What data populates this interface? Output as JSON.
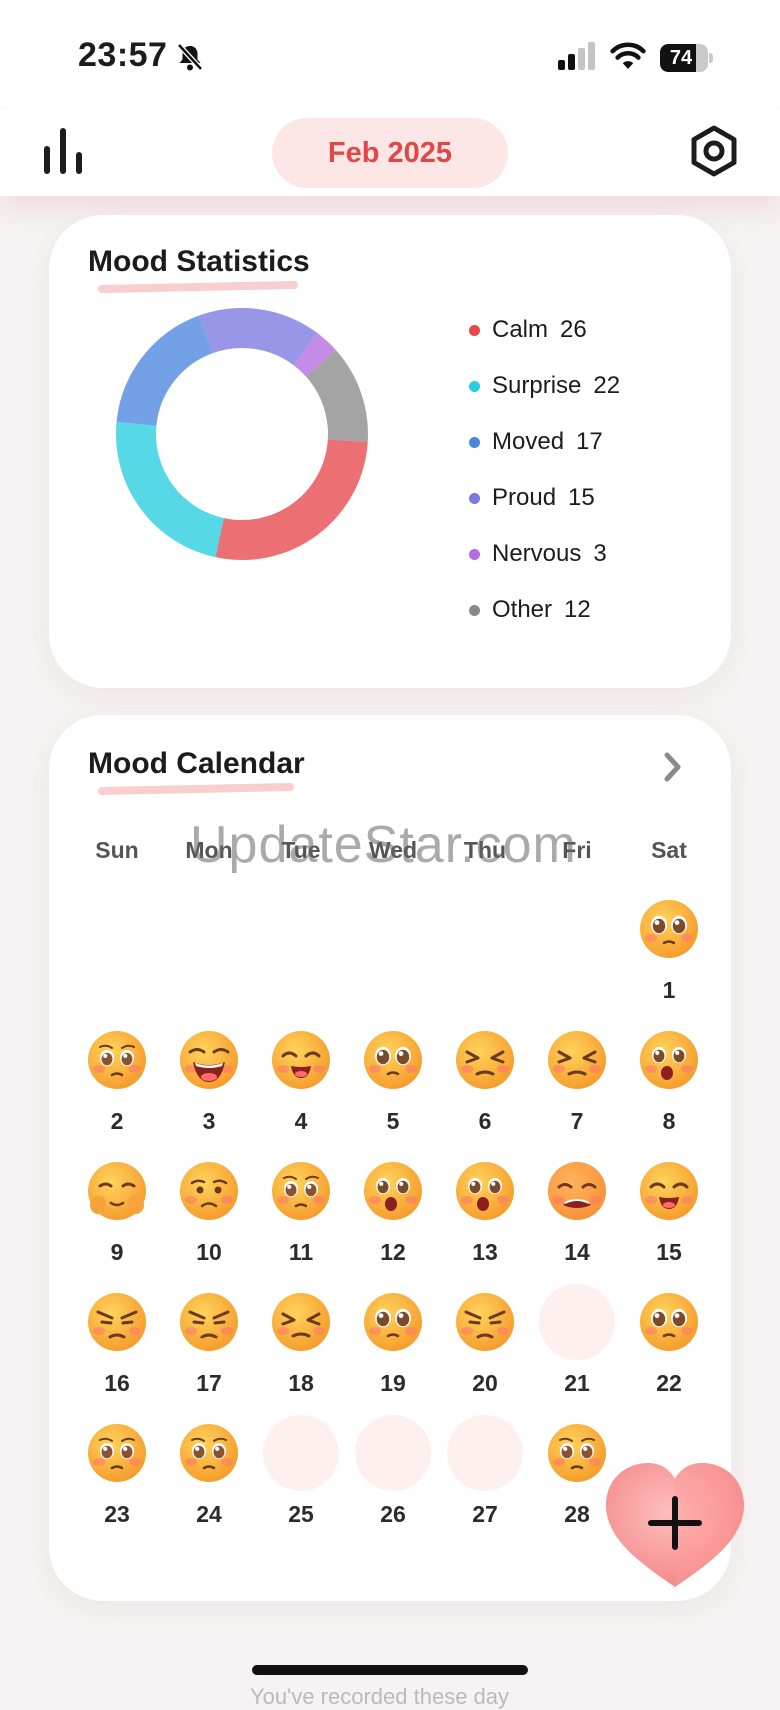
{
  "status_bar": {
    "time": "23:57",
    "battery": "74",
    "battery_level": 0.74
  },
  "header": {
    "month": "Feb 2025",
    "left_icon": "bar-chart-icon",
    "right_icon": "settings-icon"
  },
  "stats": {
    "title": "Mood Statistics",
    "legend": [
      {
        "label": "Calm",
        "count": "26",
        "color": "#e5474b"
      },
      {
        "label": "Surprise",
        "count": "22",
        "color": "#27cde0"
      },
      {
        "label": "Moved",
        "count": "17",
        "color": "#4a86e0"
      },
      {
        "label": "Proud",
        "count": "15",
        "color": "#7b78e0"
      },
      {
        "label": "Nervous",
        "count": "3",
        "color": "#b36be0"
      },
      {
        "label": "Other",
        "count": "12",
        "color": "#8a8a8a"
      }
    ]
  },
  "calendar": {
    "title": "Mood Calendar",
    "weekdays": [
      "Sun",
      "Mon",
      "Tue",
      "Wed",
      "Thu",
      "Fri",
      "Sat"
    ],
    "first_day_column": 6,
    "days": [
      {
        "day": "1",
        "mood": "hopeful"
      },
      {
        "day": "2",
        "mood": "teary"
      },
      {
        "day": "3",
        "mood": "laughing"
      },
      {
        "day": "4",
        "mood": "happy"
      },
      {
        "day": "5",
        "mood": "hopeful"
      },
      {
        "day": "6",
        "mood": "squint"
      },
      {
        "day": "7",
        "mood": "squint"
      },
      {
        "day": "8",
        "mood": "surprised"
      },
      {
        "day": "9",
        "mood": "shy"
      },
      {
        "day": "10",
        "mood": "sad"
      },
      {
        "day": "11",
        "mood": "teary"
      },
      {
        "day": "12",
        "mood": "surprised"
      },
      {
        "day": "13",
        "mood": "surprised"
      },
      {
        "day": "14",
        "mood": "upset"
      },
      {
        "day": "15",
        "mood": "happy"
      },
      {
        "day": "16",
        "mood": "angry"
      },
      {
        "day": "17",
        "mood": "angry"
      },
      {
        "day": "18",
        "mood": "squint"
      },
      {
        "day": "19",
        "mood": "hopeful"
      },
      {
        "day": "20",
        "mood": "angry"
      },
      {
        "day": "21",
        "mood": ""
      },
      {
        "day": "22",
        "mood": "hopeful"
      },
      {
        "day": "23",
        "mood": "teary"
      },
      {
        "day": "24",
        "mood": "teary"
      },
      {
        "day": "25",
        "mood": ""
      },
      {
        "day": "26",
        "mood": ""
      },
      {
        "day": "27",
        "mood": ""
      },
      {
        "day": "28",
        "mood": "teary"
      }
    ]
  },
  "watermark": "UpdateStar.com",
  "fab_icon": "heart-plus-icon",
  "bottom_text": "You've recorded these day"
}
